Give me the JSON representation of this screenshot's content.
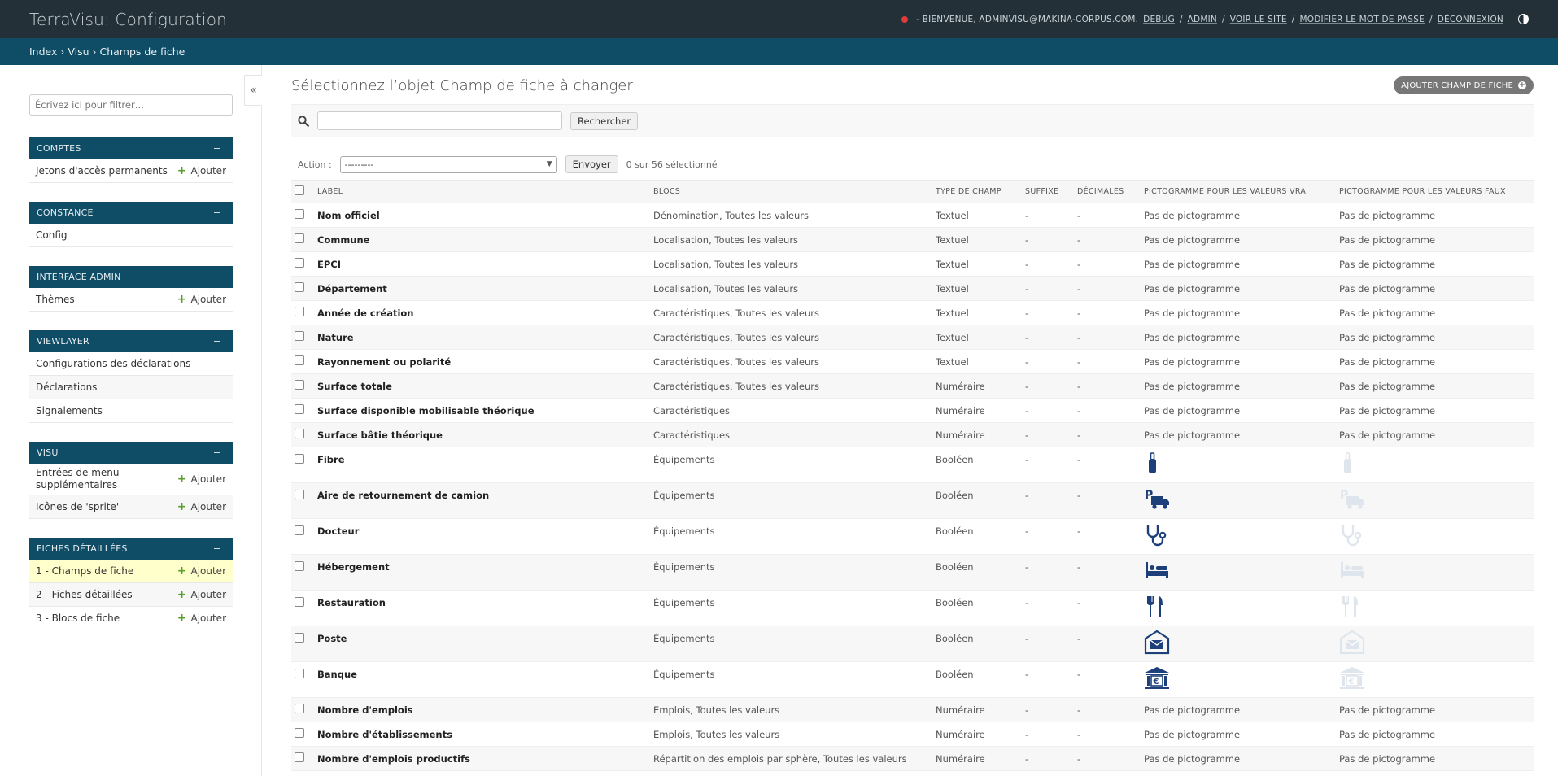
{
  "header": {
    "brand": "TerraVisu: Configuration",
    "welcome": "- BIENVENUE, ADMINVISU@MAKINA-CORPUS.COM.",
    "links": [
      "DEBUG",
      "ADMIN",
      "VOIR LE SITE",
      "MODIFIER LE MOT DE PASSE",
      "DÉCONNEXION"
    ],
    "separator": "/"
  },
  "breadcrumbs": {
    "text": "Index › Visu › Champs de fiche"
  },
  "sidebar": {
    "toggle": "«",
    "filter_placeholder": "Écrivez ici pour filtrer…",
    "add_label": "Ajouter",
    "modules": [
      {
        "caption": "COMPTES",
        "items": [
          {
            "label": "Jetons d'accès permanents",
            "add": true
          }
        ]
      },
      {
        "caption": "CONSTANCE",
        "items": [
          {
            "label": "Config",
            "add": false
          }
        ]
      },
      {
        "caption": "INTERFACE ADMIN",
        "items": [
          {
            "label": "Thèmes",
            "add": true
          }
        ]
      },
      {
        "caption": "VIEWLAYER",
        "items": [
          {
            "label": "Configurations des déclarations",
            "add": false
          },
          {
            "label": "Déclarations",
            "add": false
          },
          {
            "label": "Signalements",
            "add": false
          }
        ]
      },
      {
        "caption": "VISU",
        "items": [
          {
            "label": "Entrées de menu supplémentaires",
            "add": true
          },
          {
            "label": "Icônes de 'sprite'",
            "add": true
          }
        ]
      },
      {
        "caption": "FICHES DÉTAILLÉES",
        "items": [
          {
            "label": "1 - Champs de fiche",
            "add": true,
            "active": true
          },
          {
            "label": "2 - Fiches détaillées",
            "add": true
          },
          {
            "label": "3 - Blocs de fiche",
            "add": true
          }
        ]
      }
    ]
  },
  "content": {
    "title": "Sélectionnez l’objet Champ de fiche à changer",
    "add_button": "AJOUTER CHAMP DE FICHE",
    "search_button": "Rechercher",
    "action_label": "Action :",
    "action_default": "---------",
    "send_button": "Envoyer",
    "selection_count": "0 sur 56 sélectionné"
  },
  "table": {
    "columns": [
      "LABEL",
      "BLOCS",
      "TYPE DE CHAMP",
      "SUFFIXE",
      "DÉCIMALES",
      "PICTOGRAMME POUR LES VALEURS VRAI",
      "PICTOGRAMME POUR LES VALEURS FAUX"
    ],
    "rows": [
      {
        "label": "Nom officiel",
        "blocs": "Dénomination, Toutes les valeurs",
        "type": "Textuel",
        "suffix": "-",
        "decimals": "-",
        "true": "Pas de pictogramme",
        "false": "Pas de pictogramme"
      },
      {
        "label": "Commune",
        "blocs": "Localisation, Toutes les valeurs",
        "type": "Textuel",
        "suffix": "-",
        "decimals": "-",
        "true": "Pas de pictogramme",
        "false": "Pas de pictogramme"
      },
      {
        "label": "EPCI",
        "blocs": "Localisation, Toutes les valeurs",
        "type": "Textuel",
        "suffix": "-",
        "decimals": "-",
        "true": "Pas de pictogramme",
        "false": "Pas de pictogramme"
      },
      {
        "label": "Département",
        "blocs": "Localisation, Toutes les valeurs",
        "type": "Textuel",
        "suffix": "-",
        "decimals": "-",
        "true": "Pas de pictogramme",
        "false": "Pas de pictogramme"
      },
      {
        "label": "Année de création",
        "blocs": "Caractéristiques, Toutes les valeurs",
        "type": "Textuel",
        "suffix": "-",
        "decimals": "-",
        "true": "Pas de pictogramme",
        "false": "Pas de pictogramme"
      },
      {
        "label": "Nature",
        "blocs": "Caractéristiques, Toutes les valeurs",
        "type": "Textuel",
        "suffix": "-",
        "decimals": "-",
        "true": "Pas de pictogramme",
        "false": "Pas de pictogramme"
      },
      {
        "label": "Rayonnement ou polarité",
        "blocs": "Caractéristiques, Toutes les valeurs",
        "type": "Textuel",
        "suffix": "-",
        "decimals": "-",
        "true": "Pas de pictogramme",
        "false": "Pas de pictogramme"
      },
      {
        "label": "Surface totale",
        "blocs": "Caractéristiques, Toutes les valeurs",
        "type": "Numéraire",
        "suffix": "-",
        "decimals": "-",
        "true": "Pas de pictogramme",
        "false": "Pas de pictogramme"
      },
      {
        "label": "Surface disponible mobilisable théorique",
        "blocs": "Caractéristiques",
        "type": "Numéraire",
        "suffix": "-",
        "decimals": "-",
        "true": "Pas de pictogramme",
        "false": "Pas de pictogramme"
      },
      {
        "label": "Surface bâtie théorique",
        "blocs": "Caractéristiques",
        "type": "Numéraire",
        "suffix": "-",
        "decimals": "-",
        "true": "Pas de pictogramme",
        "false": "Pas de pictogramme"
      },
      {
        "label": "Fibre",
        "blocs": "Équipements",
        "type": "Booléen",
        "suffix": "-",
        "decimals": "-",
        "icon": "fibre-icon"
      },
      {
        "label": "Aire de retournement de camion",
        "blocs": "Équipements",
        "type": "Booléen",
        "suffix": "-",
        "decimals": "-",
        "icon": "truck-parking-icon"
      },
      {
        "label": "Docteur",
        "blocs": "Équipements",
        "type": "Booléen",
        "suffix": "-",
        "decimals": "-",
        "icon": "stethoscope-icon"
      },
      {
        "label": "Hébergement",
        "blocs": "Équipements",
        "type": "Booléen",
        "suffix": "-",
        "decimals": "-",
        "icon": "bed-icon"
      },
      {
        "label": "Restauration",
        "blocs": "Équipements",
        "type": "Booléen",
        "suffix": "-",
        "decimals": "-",
        "icon": "fork-knife-icon"
      },
      {
        "label": "Poste",
        "blocs": "Équipements",
        "type": "Booléen",
        "suffix": "-",
        "decimals": "-",
        "icon": "mail-icon"
      },
      {
        "label": "Banque",
        "blocs": "Équipements",
        "type": "Booléen",
        "suffix": "-",
        "decimals": "-",
        "icon": "bank-icon"
      },
      {
        "label": "Nombre d'emplois",
        "blocs": "Emplois, Toutes les valeurs",
        "type": "Numéraire",
        "suffix": "-",
        "decimals": "-",
        "true": "Pas de pictogramme",
        "false": "Pas de pictogramme"
      },
      {
        "label": "Nombre d'établissements",
        "blocs": "Emplois, Toutes les valeurs",
        "type": "Numéraire",
        "suffix": "-",
        "decimals": "-",
        "true": "Pas de pictogramme",
        "false": "Pas de pictogramme"
      },
      {
        "label": "Nombre d'emplois productifs",
        "blocs": "Répartition des emplois par sphère, Toutes les valeurs",
        "type": "Numéraire",
        "suffix": "-",
        "decimals": "-",
        "true": "Pas de pictogramme",
        "false": "Pas de pictogramme"
      }
    ]
  },
  "colors": {
    "header_bg": "#243038",
    "breadcrumb_bg": "#0f4c66",
    "module_caption_bg": "#0f4c66",
    "picto_true": "#1d3f7a",
    "picto_false": "#dfe5ec",
    "active_row": "#ffffcc",
    "add_plus": "#5a9f2a"
  }
}
